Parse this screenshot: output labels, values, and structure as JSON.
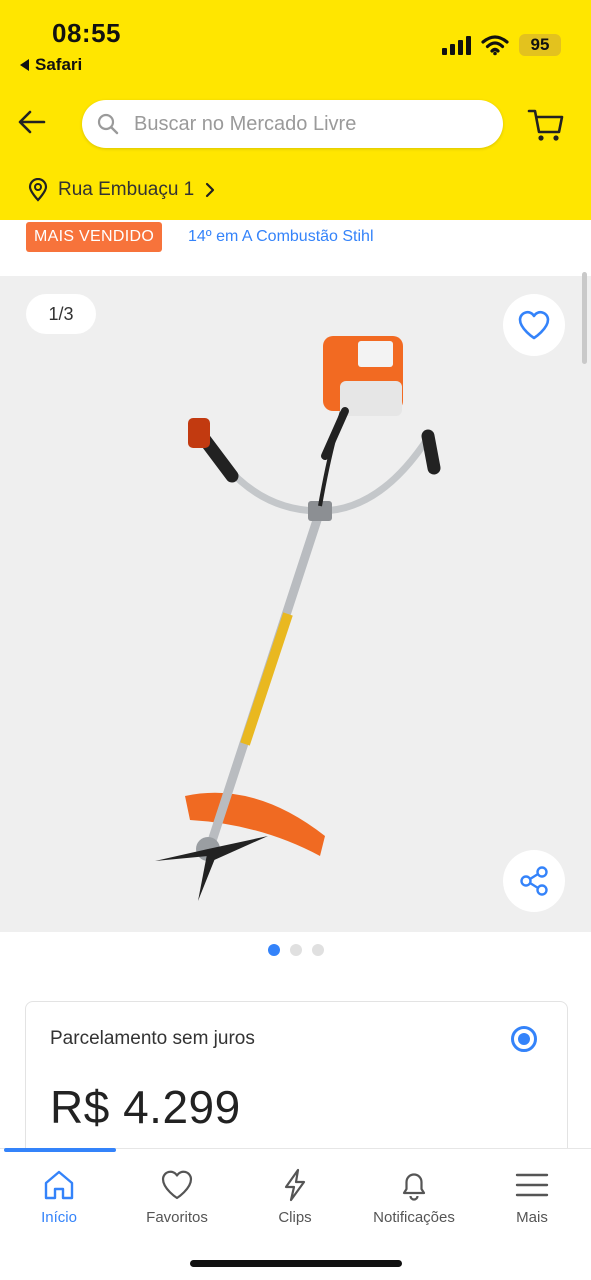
{
  "status_bar": {
    "time": "08:55",
    "back_app": "Safari",
    "battery": "95"
  },
  "header": {
    "search_placeholder": "Buscar no Mercado Livre",
    "location": "Rua Embuaçu 1",
    "icons": [
      "back-arrow-icon",
      "search-icon",
      "cart-icon",
      "location-pin-icon",
      "chevron-right-icon"
    ]
  },
  "badge_row": {
    "badge": "MAIS VENDIDO",
    "ranking": "14º em A Combustão Stihl"
  },
  "gallery": {
    "counter": "1/3",
    "image_count": 3,
    "active_image": 1
  },
  "price_card": {
    "plan": "Parcelamento sem juros",
    "price": "R$ 4.299",
    "selected": true
  },
  "bottom_nav": {
    "items": [
      {
        "label": "Início",
        "icon": "home-icon",
        "active": true
      },
      {
        "label": "Favoritos",
        "icon": "heart-icon",
        "active": false
      },
      {
        "label": "Clips",
        "icon": "lightning-icon",
        "active": false
      },
      {
        "label": "Notificações",
        "icon": "bell-icon",
        "active": false
      },
      {
        "label": "Mais",
        "icon": "menu-icon",
        "active": false
      }
    ]
  },
  "colors": {
    "brand_yellow": "#ffe600",
    "accent_blue": "#3483fa",
    "badge_orange": "#f7733b"
  }
}
